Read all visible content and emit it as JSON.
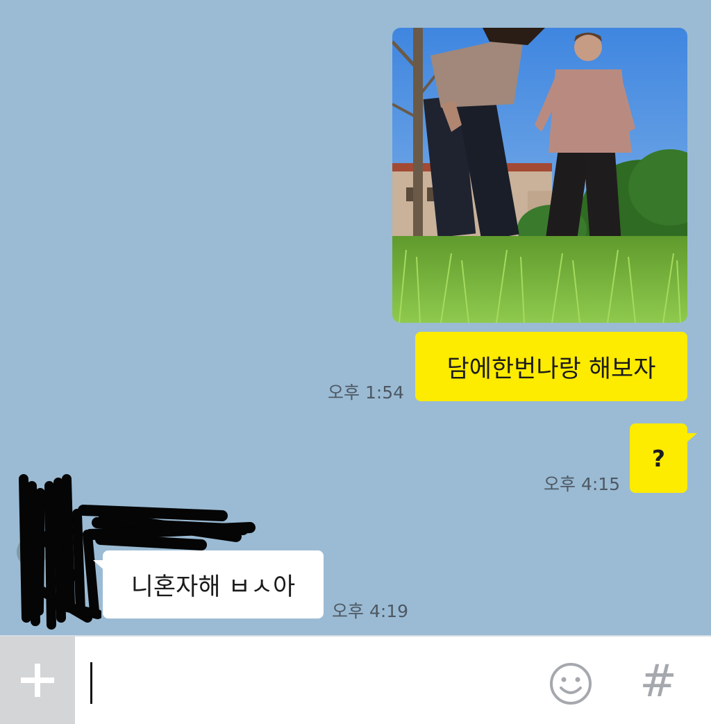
{
  "theme": {
    "background": "#9bbbd4",
    "my_bubble_color": "#fdeb00",
    "their_bubble_color": "#ffffff",
    "input_bar_color": "#ffffff",
    "plus_button_color": "#d4d5d7"
  },
  "messages": [
    {
      "sender": "me",
      "type": "image",
      "content": "photo-two-men-on-grass"
    },
    {
      "sender": "me",
      "type": "text",
      "text": "담에한번나랑 해보자",
      "time": "오후 1:54"
    },
    {
      "sender": "me",
      "type": "text",
      "text": "?",
      "time": "오후 4:15"
    },
    {
      "sender": "other",
      "type": "text",
      "text": "니혼자해 ㅂㅅ아",
      "time": "오후 4:19"
    }
  ],
  "input_bar": {
    "plus_icon": "plus-icon",
    "input_value": "",
    "emoji_icon": "smiley-face-icon",
    "hash_label": "#"
  }
}
